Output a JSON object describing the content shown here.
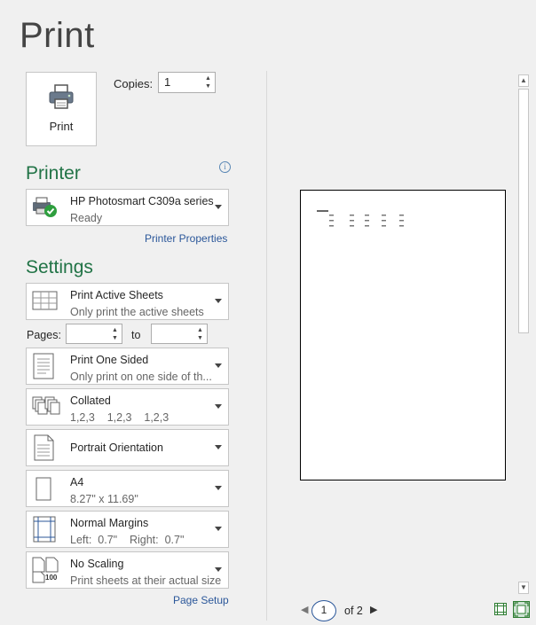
{
  "title": "Print",
  "print_button": {
    "label": "Print"
  },
  "copies": {
    "label": "Copies:",
    "value": "1"
  },
  "printer": {
    "heading": "Printer",
    "name": "HP Photosmart C309a series",
    "status": "Ready",
    "properties_link": "Printer Properties"
  },
  "settings": {
    "heading": "Settings",
    "sheets": {
      "main": "Print Active Sheets",
      "sub": "Only print the active sheets"
    },
    "pages": {
      "label": "Pages:",
      "to_label": "to",
      "from_value": "",
      "to_value": ""
    },
    "sides": {
      "main": "Print One Sided",
      "sub": "Only print on one side of th..."
    },
    "collation": {
      "main": "Collated",
      "sub": "1,2,3    1,2,3    1,2,3"
    },
    "orientation": {
      "main": "Portrait Orientation"
    },
    "paper": {
      "main": "A4",
      "sub": "8.27\" x 11.69\""
    },
    "margins": {
      "main": "Normal Margins",
      "sub": "Left:  0.7\"    Right:  0.7\""
    },
    "scaling": {
      "main": "No Scaling",
      "sub": "Print sheets at their actual size",
      "icon_text": "100"
    },
    "page_setup_link": "Page Setup"
  },
  "preview": {
    "current_page": "1",
    "total_label": "of 2"
  },
  "colors": {
    "accent_green": "#217346",
    "link_blue": "#2b579a"
  }
}
